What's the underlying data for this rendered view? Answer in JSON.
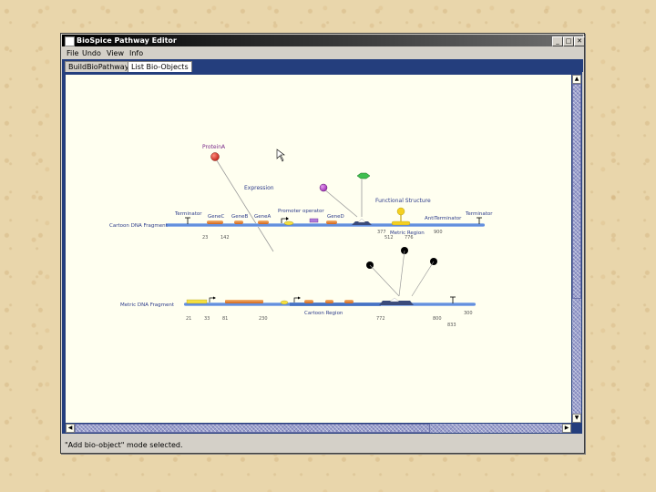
{
  "window": {
    "title": "BioSpice Pathway Editor",
    "minimize_glyph": "_",
    "maximize_glyph": "□",
    "close_glyph": "✕"
  },
  "menu": [
    "File",
    "Undo",
    "View",
    "Info"
  ],
  "tabs": [
    "BuildBioPathway",
    "List Bio-Objects"
  ],
  "diagram": {
    "protein_label": "ProteinA",
    "expression_label": "Expression",
    "functional_structure_label": "Functional Structure",
    "cartoon": {
      "fragment_label": "Cartoon DNA Fragment",
      "terminator_left": "Terminator",
      "gene_c": "GeneC",
      "gene_b": "GeneB",
      "gene_a": "GeneA",
      "promoter_operator": "Promoter operator",
      "gene_d": "GeneD",
      "anti_terminator": "AntiTerminator",
      "terminator_right": "Terminator",
      "metric_region": "Metric Region",
      "pos_23": "23",
      "pos_142": "142",
      "pos_377": "377",
      "pos_512": "512",
      "pos_776": "776",
      "pos_900": "900"
    },
    "metric": {
      "fragment_label": "Metric DNA Fragment",
      "cartoon_region": "Cartoon Region",
      "pos_21": "21",
      "pos_33": "33",
      "pos_81": "81",
      "pos_230": "230",
      "pos_772": "772",
      "pos_800": "800",
      "pos_300": "300",
      "pos_833": "833"
    }
  },
  "status": "\"Add bio-object\" mode selected.",
  "colors": {
    "desktop": "#e9d6ab",
    "titlebar": "#000000",
    "tabstrip": "#243e7d",
    "canvas": "#fffff0",
    "dna_strand": "#4d7ed6"
  }
}
